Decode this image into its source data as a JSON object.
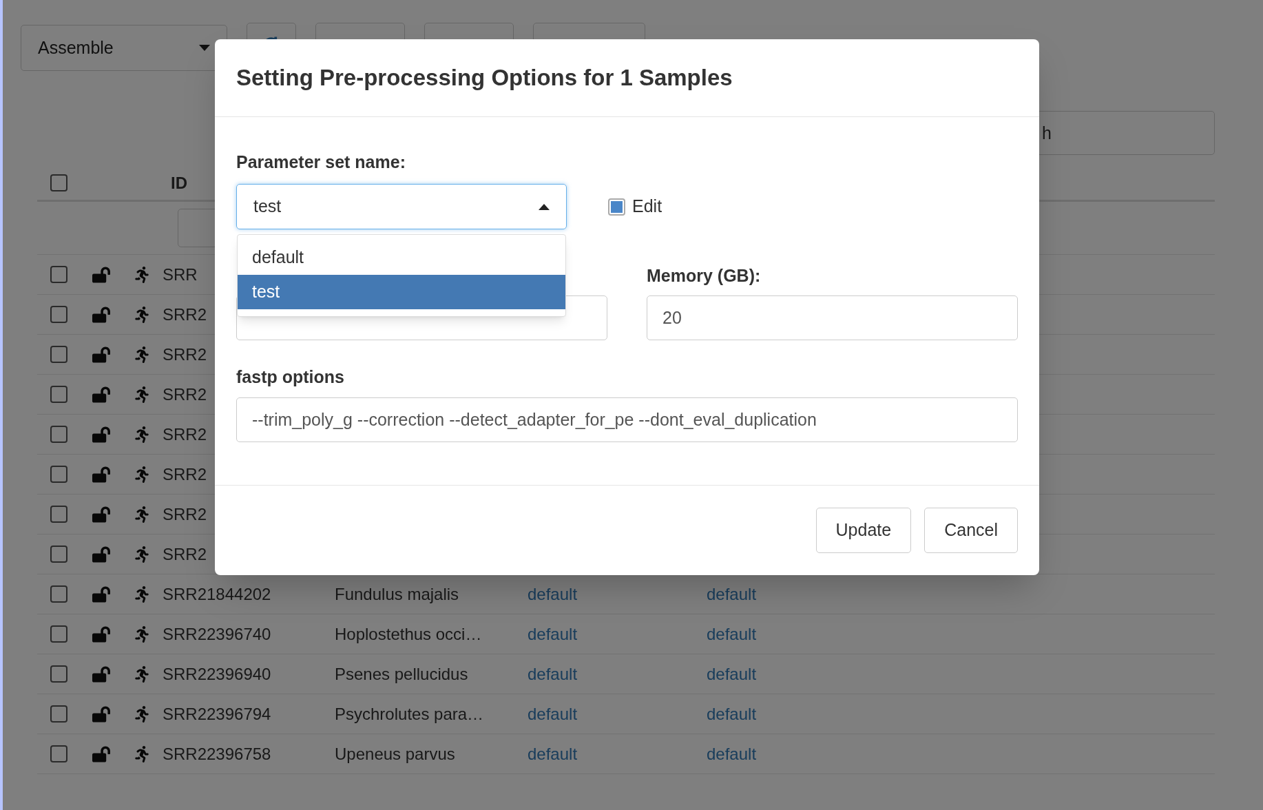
{
  "toolbar": {
    "stage_select": {
      "value": "Assemble"
    },
    "buttons": [
      {
        "kind": "icon"
      },
      {
        "kind": "text"
      },
      {
        "kind": "text"
      },
      {
        "kind": "text"
      }
    ]
  },
  "search": {
    "placeholder": "h"
  },
  "table": {
    "header": {
      "checked": false,
      "columns": [
        "ID"
      ]
    },
    "rows": [
      {
        "checked": false,
        "id": "SRR"
      },
      {
        "checked": false,
        "id": "SRR2"
      },
      {
        "checked": false,
        "id": "SRR2"
      },
      {
        "checked": false,
        "id": "SRR2"
      },
      {
        "checked": false,
        "id": "SRR2"
      },
      {
        "checked": false,
        "id": "SRR2"
      },
      {
        "checked": false,
        "id": "SRR2"
      },
      {
        "checked": false,
        "id": "SRR2"
      },
      {
        "checked": false,
        "id": "SRR21844202",
        "name": "Fundulus majalis",
        "col_3": "default",
        "col_4": "default"
      },
      {
        "checked": false,
        "id": "SRR22396740",
        "name": "Hoplostethus occi…",
        "col_3": "default",
        "col_4": "default"
      },
      {
        "checked": false,
        "id": "SRR22396940",
        "name": "Psenes pellucidus",
        "col_3": "default",
        "col_4": "default"
      },
      {
        "checked": false,
        "id": "SRR22396794",
        "name": "Psychrolutes para…",
        "col_3": "default",
        "col_4": "default"
      },
      {
        "checked": false,
        "id": "SRR22396758",
        "name": "Upeneus parvus",
        "col_3": "default",
        "col_4": "default"
      }
    ]
  },
  "dialog": {
    "title": "Setting Pre-processing Options for 1 Samples",
    "parameter_set": {
      "label": "Parameter set name:",
      "value": "test",
      "expanded": true,
      "options": [
        {
          "label": "default",
          "selected": false
        },
        {
          "label": "test",
          "selected": true
        }
      ]
    },
    "edit": {
      "label": "Edit",
      "checked": true
    },
    "threads_field": {
      "kind": "input"
    },
    "memory": {
      "label": "Memory (GB):",
      "value": "20"
    },
    "fastp": {
      "label": "fastp options",
      "value": "--trim_poly_g --correction --detect_adapter_for_pe --dont_eval_duplication"
    },
    "buttons": [
      "Update",
      "Cancel"
    ]
  }
}
